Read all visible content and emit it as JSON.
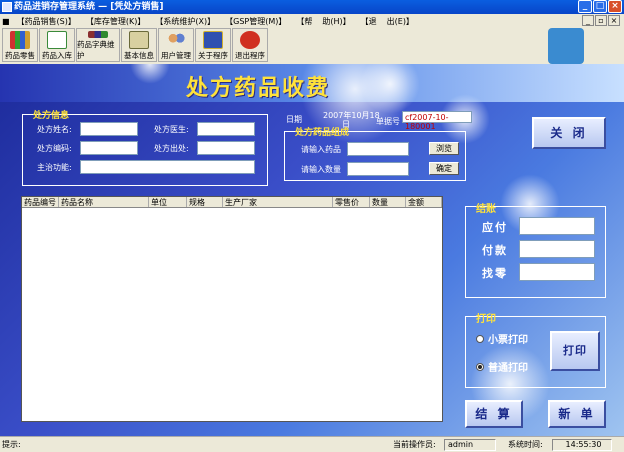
{
  "window": {
    "title": "药品进销存管理系统 — [凭处方销售]"
  },
  "menu": [
    "【药品销售(S)】",
    "【库存管理(K)】",
    "【系统维护(X)】",
    "【GSP管理(M)】",
    "【帮",
    "助(H)】",
    "【退",
    "出(E)】"
  ],
  "toolbar": [
    "药品零售",
    "药品入库",
    "药品字典维护",
    "基本信息",
    "用户管理",
    "关于程序",
    "退出程序"
  ],
  "banner": {
    "title": "处方药品收费"
  },
  "patient": {
    "legend": "处方信息",
    "name_label": "处方姓名:",
    "doctor_label": "处方医生:",
    "code_label": "处方编码:",
    "source_label": "处方出处:",
    "function_label": "主治功能:"
  },
  "date": {
    "label": "日期",
    "value_line1": "2007年10月18",
    "value_line2": "日",
    "no_label": "单据号",
    "no_value": "cf2007-10-180001"
  },
  "compose": {
    "legend": "处方药品组成",
    "drug_label": "请输入药品",
    "qty_label": "请输入数量",
    "browse_btn": "浏览",
    "ok_btn": "确定"
  },
  "close_btn": "关  闭",
  "grid": {
    "columns": [
      "药品编号",
      "药品名称",
      "单位",
      "规格",
      "生产厂家",
      "零售价",
      "数量",
      "金额"
    ]
  },
  "checkout": {
    "legend": "结账",
    "due_label": "应付",
    "paid_label": "付款",
    "change_label": "找零"
  },
  "print": {
    "legend": "打印",
    "opt_small": "小票打印",
    "opt_normal": "普通打印",
    "print_btn": "打印"
  },
  "settle_btn": "结 算",
  "new_btn": "新 单",
  "status": {
    "hint_label": "提示:",
    "operator_label": "当前操作员:",
    "operator": "admin",
    "time_label": "系统时间:",
    "time": "14:55:30"
  }
}
